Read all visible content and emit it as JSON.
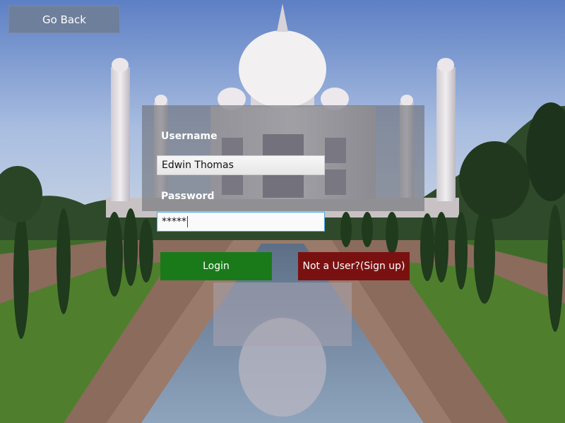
{
  "nav": {
    "go_back_label": "Go Back"
  },
  "form": {
    "username_label": "Username",
    "username_value": "Edwin Thomas",
    "password_label": "Password",
    "password_value": "*****"
  },
  "actions": {
    "login_label": "Login",
    "signup_label": "Not a User?(Sign up)"
  },
  "colors": {
    "go_back_bg": "#6e7f9c",
    "login_bg": "#1a7a1a",
    "signup_bg": "#7a1111",
    "panel_overlay": "rgba(110,112,118,0.62)"
  },
  "background": {
    "icon": "landmark-photo"
  }
}
